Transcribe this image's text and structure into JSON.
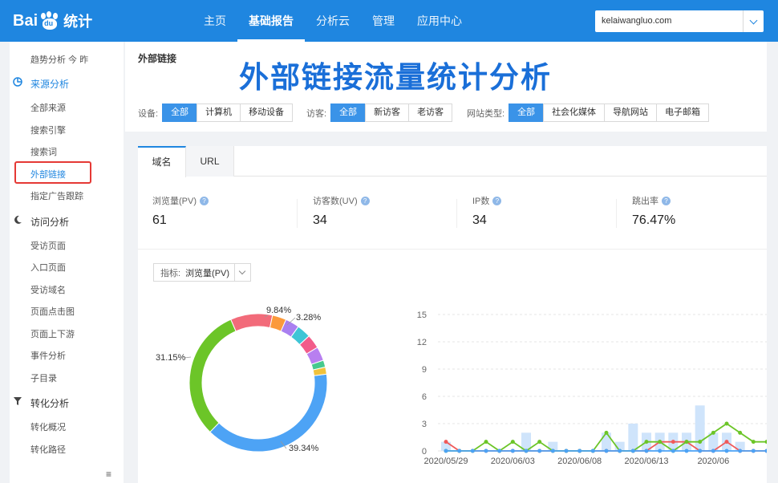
{
  "brand": {
    "logo_text": "Bai",
    "logo_paw_text": "du",
    "logo_suffix": "统计"
  },
  "nav": [
    "主页",
    "基础报告",
    "分析云",
    "管理",
    "应用中心"
  ],
  "nav_active_index": 1,
  "site_select": {
    "value": "kelaiwangluo.com"
  },
  "sidebar": {
    "top_label": "趋势分析   今   昨",
    "groups": [
      {
        "label": "来源分析",
        "icon": "pie-icon",
        "active": true,
        "items": [
          "全部来源",
          "搜索引擎",
          "搜索词",
          "外部链接",
          "指定广告跟踪"
        ]
      },
      {
        "label": "访问分析",
        "icon": "moon-icon",
        "items": [
          "受访页面",
          "入口页面",
          "受访域名",
          "页面点击图",
          "页面上下游",
          "事件分析",
          "子目录"
        ]
      },
      {
        "label": "转化分析",
        "icon": "funnel-icon",
        "items": [
          "转化概况",
          "转化路径"
        ]
      }
    ],
    "selected_item": "外部链接",
    "bottom_icon": "≡"
  },
  "filter_panel": {
    "title": "外部链接",
    "overlay_title": "外部链接流量统计分析",
    "device": {
      "label": "设备:",
      "options": [
        "全部",
        "计算机",
        "移动设备"
      ],
      "selected": 0
    },
    "visitor": {
      "label": "访客:",
      "options": [
        "全部",
        "新访客",
        "老访客"
      ],
      "selected": 0
    },
    "site_type": {
      "label": "网站类型:",
      "options": [
        "全部",
        "社会化媒体",
        "导航网站",
        "电子邮箱"
      ],
      "selected": 0
    }
  },
  "tabs": [
    "域名",
    "URL"
  ],
  "tab_active": 0,
  "metrics": [
    {
      "label": "浏览量(PV)",
      "value": "61"
    },
    {
      "label": "访客数(UV)",
      "value": "34"
    },
    {
      "label": "IP数",
      "value": "34"
    },
    {
      "label": "跳出率",
      "value": "76.47%"
    }
  ],
  "indicator": {
    "label": "指标:",
    "value": "浏览量(PV)"
  },
  "chart_data": [
    {
      "type": "pie",
      "labels_shown": [
        "39.34%",
        "31.15%",
        "9.84%",
        "3.28%"
      ],
      "slices": [
        {
          "percent": 39.34,
          "color": "#4da3f5"
        },
        {
          "percent": 31.15,
          "color": "#6cc528"
        },
        {
          "percent": 9.84,
          "color": "#f26b7a"
        },
        {
          "percent": 3.28,
          "color": "#fb9a3c"
        },
        {
          "percent": 3.28,
          "color": "#a97ff0"
        },
        {
          "percent": 3.28,
          "color": "#3ec5d6"
        },
        {
          "percent": 3.28,
          "color": "#f25c8a"
        },
        {
          "percent": 3.28,
          "color": "#b87ff0"
        },
        {
          "percent": 1.64,
          "color": "#46c98e"
        },
        {
          "percent": 1.64,
          "color": "#f0c23c"
        }
      ]
    },
    {
      "type": "line",
      "y_ticks": [
        0,
        3,
        6,
        9,
        12,
        15
      ],
      "ylim": [
        0,
        15
      ],
      "x_tick_labels": [
        "2020/05/29",
        "2020/06/03",
        "2020/06/08",
        "2020/06/13",
        "2020/06"
      ],
      "bars": [
        1,
        0,
        0,
        0,
        0,
        0,
        0,
        2,
        0,
        1,
        1,
        0,
        0,
        0,
        0,
        0,
        0,
        0,
        0,
        0,
        0,
        0,
        2,
        3,
        4,
        2,
        2,
        4,
        0,
        5,
        1,
        1,
        1,
        2,
        1,
        2,
        0,
        1,
        1,
        0,
        0,
        0,
        5,
        1,
        1,
        0,
        0,
        1,
        2
      ],
      "bar_values": [
        1,
        0,
        0,
        0,
        0,
        0,
        2,
        0,
        1,
        0,
        0,
        0,
        0,
        0,
        0,
        0,
        0,
        0,
        0,
        0,
        0,
        0,
        0,
        0,
        0,
        0,
        0,
        0,
        0,
        0
      ],
      "series": [
        {
          "color": "#f05a5a",
          "values": [
            1,
            0,
            0,
            0,
            0,
            0,
            0,
            0,
            0,
            0,
            0,
            0,
            0,
            0,
            0,
            0,
            1,
            1,
            1,
            0,
            0,
            1,
            0,
            0,
            0
          ]
        },
        {
          "color": "#6cc528",
          "values": [
            0,
            0,
            0,
            1,
            0,
            1,
            0,
            1,
            0,
            0,
            0,
            0,
            2,
            0,
            0,
            1,
            1,
            0,
            1,
            1,
            2,
            3,
            2,
            1,
            1
          ]
        },
        {
          "color": "#4da3f5",
          "values": [
            0,
            0,
            0,
            0,
            0,
            0,
            0,
            0,
            0,
            0,
            0,
            0,
            0,
            0,
            0,
            0,
            0,
            0,
            0,
            0,
            0,
            0,
            0,
            0,
            0
          ]
        }
      ],
      "bar_heights": [
        1,
        0,
        0,
        0,
        0,
        0,
        2,
        0,
        1,
        0,
        0,
        0,
        2,
        1,
        3,
        2,
        2,
        2,
        2,
        5,
        2,
        2,
        1,
        0,
        0
      ],
      "bar_color": "#cfe4fb"
    }
  ]
}
